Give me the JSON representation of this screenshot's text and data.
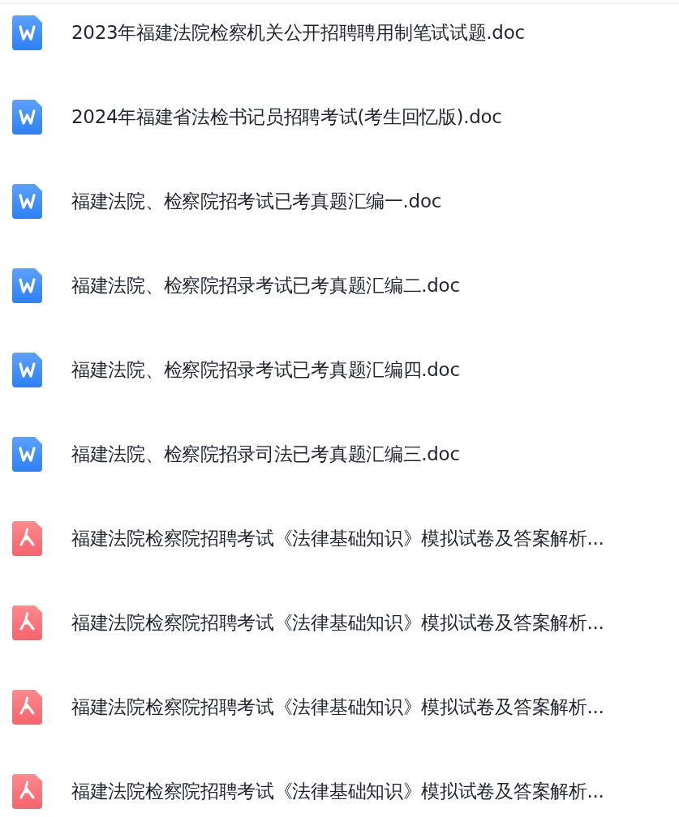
{
  "files": [
    {
      "kind": "word",
      "name": "2023年福建法院检察机关公开招聘聘用制笔试试题.doc"
    },
    {
      "kind": "word",
      "name": "2024年福建省法检书记员招聘考试(考生回忆版).doc"
    },
    {
      "kind": "word",
      "name": "福建法院、检察院招考试已考真题汇编一.doc"
    },
    {
      "kind": "word",
      "name": "福建法院、检察院招录考试已考真题汇编二.doc"
    },
    {
      "kind": "word",
      "name": "福建法院、检察院招录考试已考真题汇编四.doc"
    },
    {
      "kind": "word",
      "name": "福建法院、检察院招录司法已考真题汇编三.doc"
    },
    {
      "kind": "pdf",
      "name": "福建法院检察院招聘考试《法律基础知识》模拟试卷及答案解析..."
    },
    {
      "kind": "pdf",
      "name": "福建法院检察院招聘考试《法律基础知识》模拟试卷及答案解析..."
    },
    {
      "kind": "pdf",
      "name": "福建法院检察院招聘考试《法律基础知识》模拟试卷及答案解析..."
    },
    {
      "kind": "pdf",
      "name": "福建法院检察院招聘考试《法律基础知识》模拟试卷及答案解析..."
    }
  ]
}
